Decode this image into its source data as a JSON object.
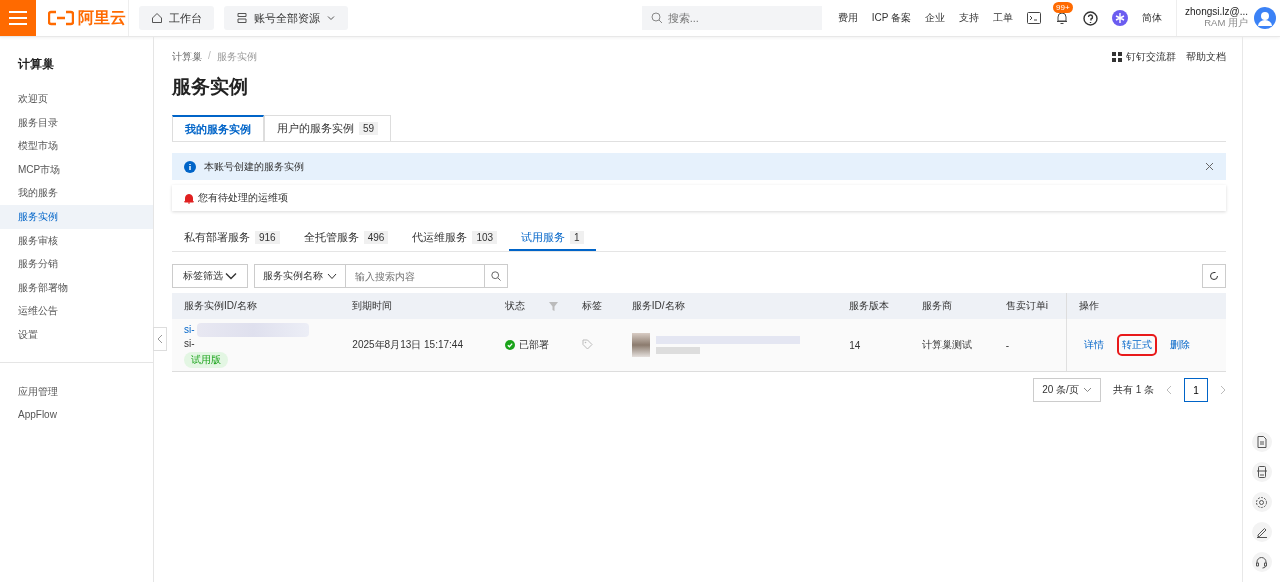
{
  "topbar": {
    "logo": "阿里云",
    "workbench": "工作台",
    "resources": "账号全部资源",
    "search_placeholder": "搜索...",
    "links": [
      "费用",
      "ICP 备案",
      "企业",
      "支持",
      "工单"
    ],
    "notification_badge": "99+",
    "language": "简体",
    "user": "zhongsi.lz@...",
    "user_role": "RAM 用户"
  },
  "sidebar": {
    "title": "计算巢",
    "items": [
      {
        "label": "欢迎页",
        "selected": false
      },
      {
        "label": "服务目录",
        "selected": false
      },
      {
        "label": "模型市场",
        "selected": false
      },
      {
        "label": "MCP市场",
        "selected": false
      },
      {
        "label": "我的服务",
        "selected": false
      },
      {
        "label": "服务实例",
        "selected": true
      },
      {
        "label": "服务审核",
        "selected": false
      },
      {
        "label": "服务分销",
        "selected": false
      },
      {
        "label": "服务部署物",
        "selected": false
      },
      {
        "label": "运维公告",
        "selected": false
      },
      {
        "label": "设置",
        "selected": false
      }
    ],
    "bottom_items": [
      {
        "label": "应用管理",
        "selected": false
      },
      {
        "label": "AppFlow",
        "selected": false
      }
    ]
  },
  "breadcrumb": [
    "计算巢",
    "服务实例"
  ],
  "breadcrumb_separator": "/",
  "header_links": [
    "钉钉交流群",
    "帮助文档"
  ],
  "page_title": "服务实例",
  "tabs": [
    {
      "label": "我的服务实例",
      "selected": true
    },
    {
      "label": "用户的服务实例",
      "count": "59",
      "selected": false
    }
  ],
  "info_alert": "本账号创建的服务实例",
  "ops_notice": "您有待处理的运维项",
  "subtabs": [
    {
      "label": "私有部署服务",
      "count": "916",
      "selected": false
    },
    {
      "label": "全托管服务",
      "count": "496",
      "selected": false
    },
    {
      "label": "代运维服务",
      "count": "103",
      "selected": false
    },
    {
      "label": "试用服务",
      "count": "1",
      "selected": true
    }
  ],
  "filters": {
    "tag_filter": "标签筛选",
    "field_select": "服务实例名称",
    "search_placeholder": "输入搜索内容"
  },
  "table": {
    "columns": [
      "服务实例ID/名称",
      "到期时间",
      "状态",
      "标签",
      "服务ID/名称",
      "服务版本",
      "服务商",
      "售卖订单i",
      "操作"
    ],
    "rows": [
      {
        "id_line1": "si-",
        "id_line2": "si-",
        "badge": "试用版",
        "expires": "2025年8月13日 15:17:44",
        "status": "已部署",
        "version": "14",
        "vendor": "计算巢测试",
        "order": "-",
        "actions": [
          {
            "label": "详情",
            "highlighted": false
          },
          {
            "label": "转正式",
            "highlighted": true
          },
          {
            "label": "删除",
            "highlighted": false
          }
        ]
      }
    ]
  },
  "pagination": {
    "page_size": "20 条/页",
    "total": "共有 1 条",
    "pages": [
      {
        "label": "1",
        "selected": true
      }
    ]
  }
}
